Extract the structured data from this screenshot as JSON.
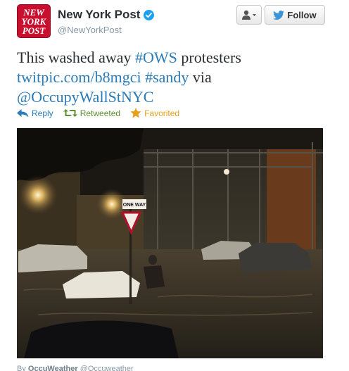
{
  "account": {
    "logo_text": [
      "NEW",
      "YORK",
      "POST"
    ],
    "name": "New York Post",
    "handle": "@NewYorkPost",
    "verified_icon": "verified-badge-icon"
  },
  "buttons": {
    "user_menu_icon": "user-dropdown-icon",
    "follow_label": "Follow",
    "follow_icon": "bird-icon"
  },
  "tweet": {
    "segments": [
      {
        "text": "This washed away ",
        "type": "text"
      },
      {
        "text": "#OWS",
        "type": "hashtag"
      },
      {
        "text": " protesters ",
        "type": "text"
      },
      {
        "text": "twitpic.com/b8mgci",
        "type": "link"
      },
      {
        "text": " ",
        "type": "text"
      },
      {
        "text": "#sandy",
        "type": "hashtag"
      },
      {
        "text": " via ",
        "type": "text"
      },
      {
        "text": "@OccupyWallStNYC",
        "type": "mention"
      }
    ]
  },
  "actions": {
    "reply_label": "Reply",
    "retweeted_label": "Retweeted",
    "favorited_label": "Favorited"
  },
  "photo": {
    "sign_text": "ONE WAY",
    "description_icon": "flood-photo"
  },
  "credit": {
    "by_label": "By",
    "author": "OccuWeather",
    "author_handle": "@Occuweather"
  },
  "colors": {
    "link": "#2a7bb8",
    "retweeted": "#5c9132",
    "favorited": "#e5a11c",
    "logo_red": "#c8102e",
    "verified_blue": "#1da1f2"
  }
}
